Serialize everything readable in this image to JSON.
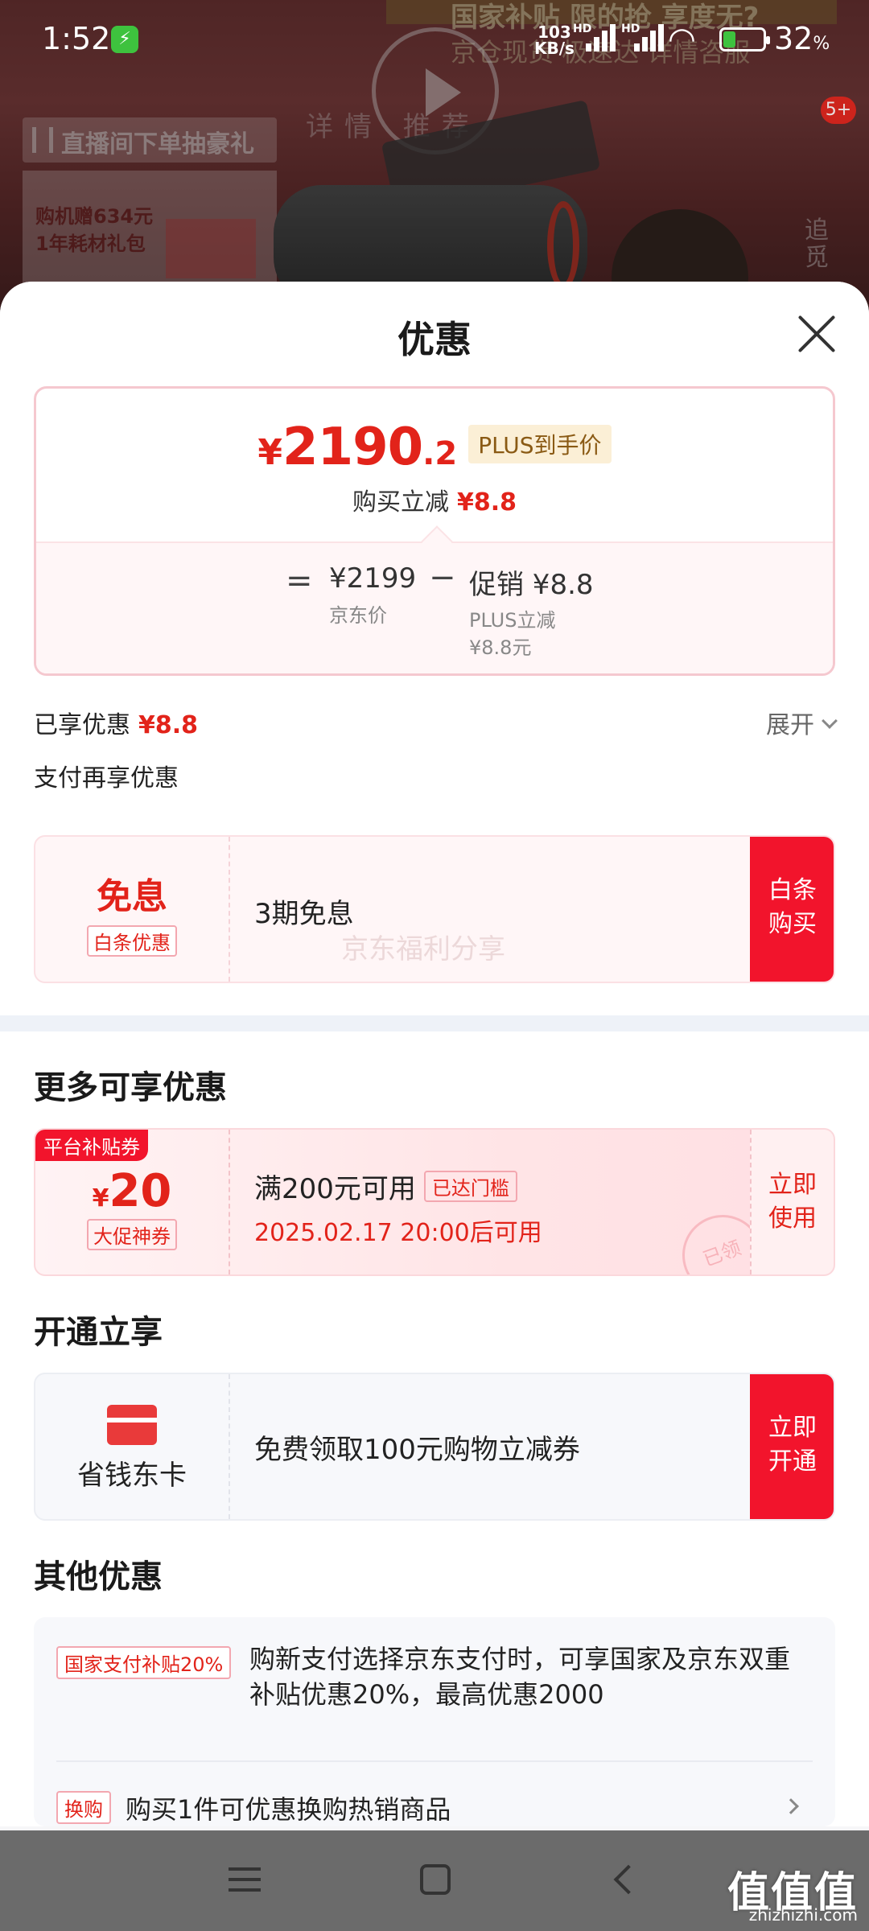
{
  "status_bar": {
    "time": "1:52",
    "net_speed": "103",
    "net_unit": "KB/s",
    "hd1": "HD",
    "hd2": "HD",
    "battery_pct": "32",
    "battery_unit": "%",
    "battery_level": 0.32
  },
  "backdrop": {
    "banner_top": "国家补贴 限的抢 享度无?",
    "banner_sub": "京仓现货 极速达 详情咨服",
    "nav_tabs": "详情 推荐",
    "live_tag": "直播间下单抽豪礼",
    "gift_line1": "购机赠634元",
    "gift_line2": "1年耗材礼包",
    "side_text": "追觅",
    "badge": "5+"
  },
  "sheet": {
    "title": "优惠",
    "price": {
      "currency": "¥",
      "integer": "2190",
      "decimal": ".2",
      "plus_tag": "PLUS到手价",
      "sub_label": "购买立减",
      "sub_amount": "¥8.8",
      "eq": "=",
      "jd_price": "¥2199",
      "jd_label": "京东价",
      "minus": "−",
      "promo_value": "促销 ¥8.8",
      "promo_label1": "PLUS立减",
      "promo_label2": "¥8.8元"
    },
    "enjoyed": {
      "label": "已享优惠",
      "amount": "¥8.8",
      "expand": "展开"
    },
    "pay_title": "支付再享优惠",
    "interest_free": {
      "big": "免息",
      "tag": "白条优惠",
      "text": "3期免息",
      "cta_line1": "白条",
      "cta_line2": "购买",
      "watermark": "京东福利分享"
    },
    "more_title": "更多可享优惠",
    "coupon": {
      "corner": "平台补贴券",
      "currency": "¥",
      "amount": "20",
      "tag": "大促神券",
      "text": "满200元可用",
      "badge": "已达门槛",
      "date": "2025.02.17 20:00后可用",
      "cta_line1": "立即",
      "cta_line2": "使用",
      "stamp": "已领"
    },
    "open_title": "开通立享",
    "card": {
      "name": "省钱东卡",
      "text": "免费领取100元购物立减券",
      "cta_line1": "立即",
      "cta_line2": "开通"
    },
    "other_title": "其他优惠",
    "other": [
      {
        "tag": "国家支付补贴20%",
        "text": "购新支付选择京东支付时，可享国家及京东双重补贴优惠20%，最高优惠2000"
      },
      {
        "tag": "换购",
        "text": "购买1件可优惠换购热销商品"
      }
    ]
  },
  "watermark_site": {
    "logo": "值值值",
    "url": "zhizhizhi.com"
  }
}
